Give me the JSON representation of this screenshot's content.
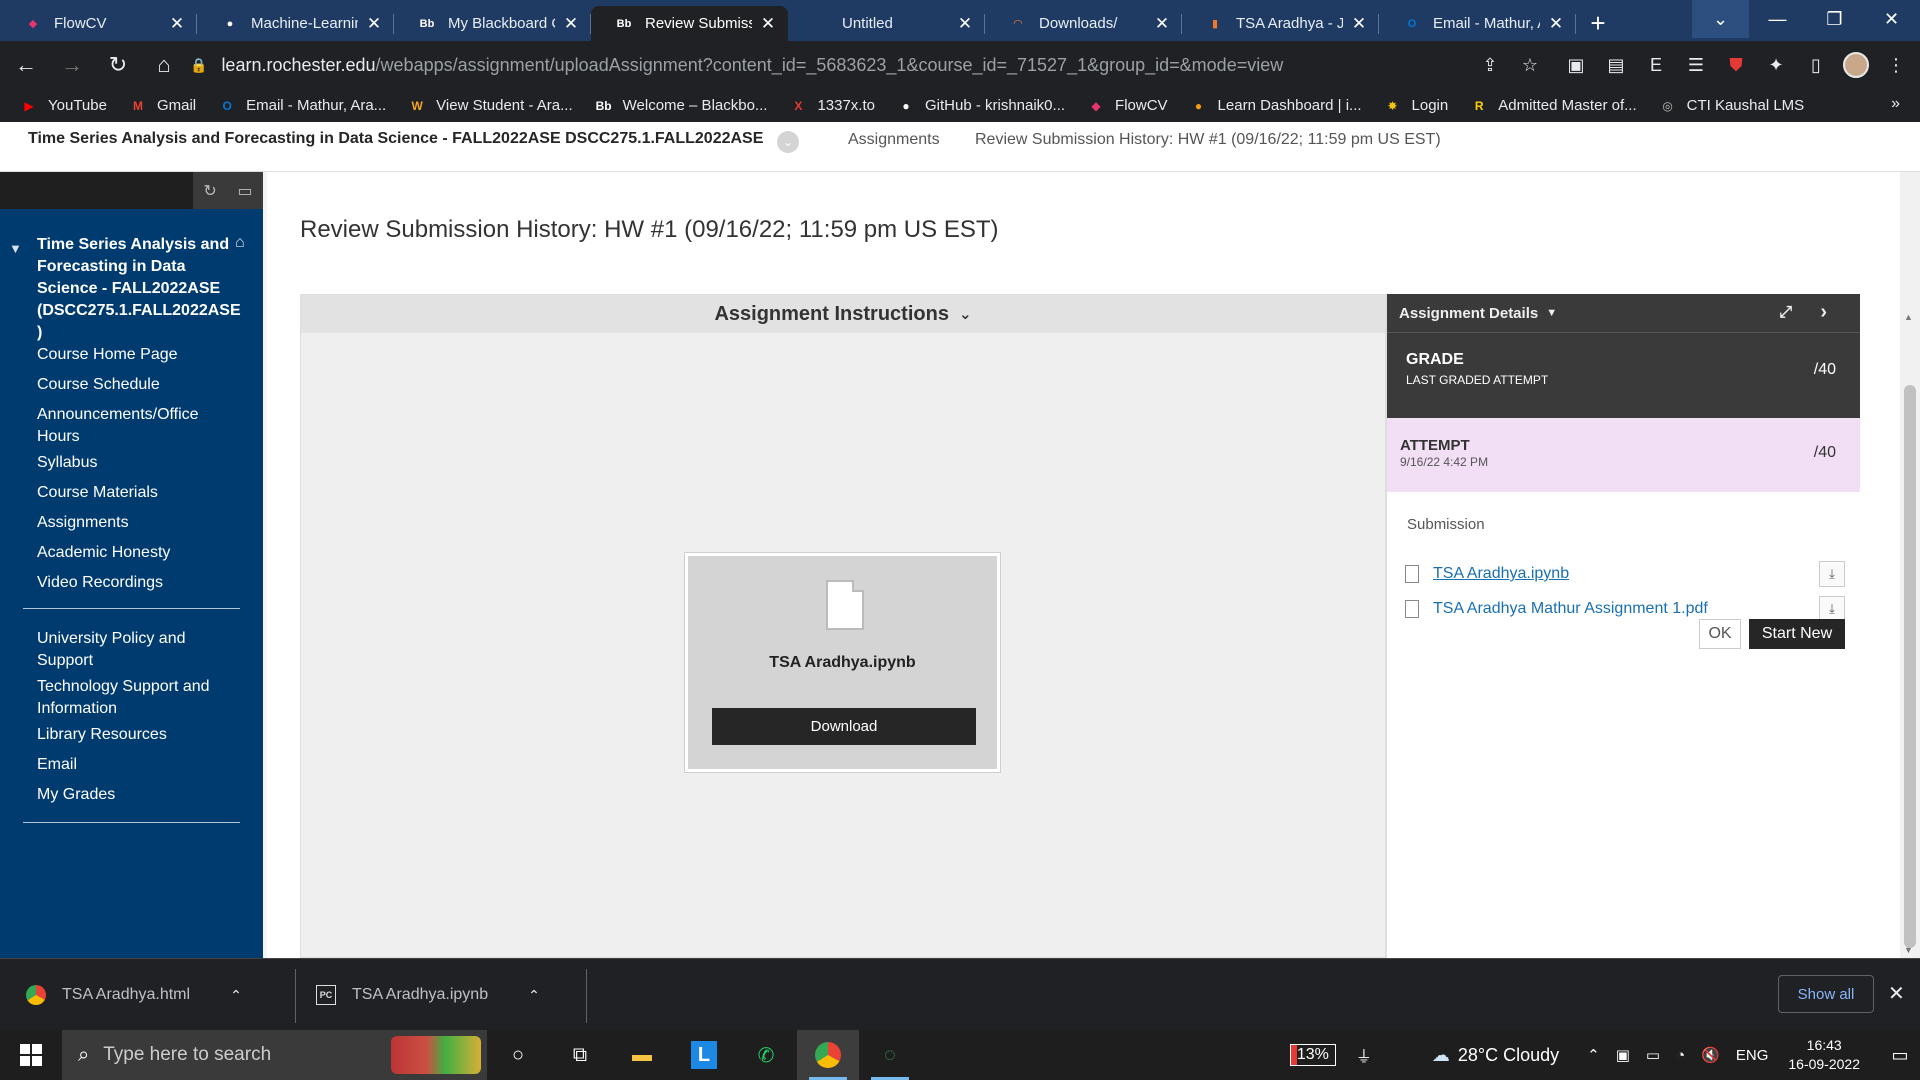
{
  "browser": {
    "tabs": [
      {
        "title": "FlowCV",
        "icon": "flowcv-icon",
        "color": "#e8336d",
        "glyph": "◆"
      },
      {
        "title": "Machine-Learning",
        "icon": "github-icon",
        "color": "#ffffff",
        "glyph": "●"
      },
      {
        "title": "My Blackboard C",
        "icon": "blackboard-icon",
        "color": "#ffffff",
        "glyph": "Bb"
      },
      {
        "title": "Review Submissio",
        "icon": "blackboard-icon",
        "color": "#ffffff",
        "glyph": "Bb",
        "active": true
      },
      {
        "title": "Untitled",
        "icon": "blank-icon",
        "color": "#ffffff",
        "glyph": ""
      },
      {
        "title": "Downloads/",
        "icon": "jupyter-icon",
        "color": "#f37726",
        "glyph": "◠"
      },
      {
        "title": "TSA Aradhya - Ju",
        "icon": "jupyter-notebook-icon",
        "color": "#f37726",
        "glyph": "▮"
      },
      {
        "title": "Email - Mathur, A",
        "icon": "outlook-icon",
        "color": "#0078d4",
        "glyph": "O"
      }
    ],
    "new_tab": "+",
    "address": {
      "domain": "learn.rochester.edu",
      "path": "/webapps/assignment/uploadAssignment?content_id=_5683623_1&course_id=_71527_1&group_id=&mode=view"
    },
    "bookmarks": [
      {
        "label": "YouTube",
        "icon": "youtube-icon",
        "color": "#ff0000",
        "glyph": "▶"
      },
      {
        "label": "Gmail",
        "icon": "gmail-icon",
        "color": "#ea4335",
        "glyph": "M"
      },
      {
        "label": "Email - Mathur, Ara...",
        "icon": "outlook-icon",
        "color": "#0078d4",
        "glyph": "O"
      },
      {
        "label": "View Student - Ara...",
        "icon": "workday-icon",
        "color": "#f5a623",
        "glyph": "W"
      },
      {
        "label": "Welcome – Blackbo...",
        "icon": "blackboard-icon",
        "color": "#ffffff",
        "glyph": "Bb"
      },
      {
        "label": "1337x.to",
        "icon": "x-icon",
        "color": "#e53935",
        "glyph": "X"
      },
      {
        "label": "GitHub - krishnaik0...",
        "icon": "github-icon",
        "color": "#ffffff",
        "glyph": "●"
      },
      {
        "label": "FlowCV",
        "icon": "flowcv-icon",
        "color": "#e8336d",
        "glyph": "◆"
      },
      {
        "label": "Learn Dashboard | i...",
        "icon": "learn-icon",
        "color": "#f39c12",
        "glyph": "●"
      },
      {
        "label": "Login",
        "icon": "login-icon",
        "color": "#f1c40f",
        "glyph": "✸"
      },
      {
        "label": "Admitted Master of...",
        "icon": "rochester-icon",
        "color": "#ffd100",
        "glyph": "R"
      },
      {
        "label": "CTI Kaushal LMS",
        "icon": "globe-icon",
        "color": "#bbbbbb",
        "glyph": "◎"
      }
    ],
    "bookmarks_more": "»"
  },
  "page": {
    "breadcrumb": {
      "course": "Time Series Analysis and Forecasting in Data Science - FALL2022ASE DSCC275.1.FALL2022ASE",
      "section": "Assignments",
      "current": "Review Submission History: HW #1 (09/16/22; 11:59 pm US EST)"
    },
    "title": "Review Submission History: HW #1 (09/16/22; 11:59 pm US EST)",
    "sidebar": {
      "course_title": "Time Series Analysis and Forecasting in Data Science - FALL2022ASE (DSCC275.1.FALL2022ASE )",
      "items": [
        "Course Home Page",
        "Course Schedule",
        "Announcements/Office Hours",
        "Syllabus",
        "Course Materials",
        "Assignments",
        "Academic Honesty",
        "Video Recordings"
      ],
      "items2": [
        "University Policy and Support",
        "Technology Support and Information",
        "Library Resources",
        "Email",
        "My Grades"
      ]
    },
    "instructions": {
      "header": "Assignment Instructions",
      "file_name": "TSA Aradhya.ipynb",
      "download_label": "Download"
    },
    "details": {
      "header": "Assignment Details",
      "grade_label": "GRADE",
      "grade_sub": "LAST GRADED ATTEMPT",
      "grade_value": "/40",
      "attempt_label": "ATTEMPT",
      "attempt_date": "9/16/22 4:42 PM",
      "attempt_value": "/40",
      "submission_label": "Submission",
      "files": [
        "TSA Aradhya.ipynb",
        "TSA Aradhya Mathur Assignment 1.pdf"
      ],
      "ok_label": "OK",
      "start_new_label": "Start New"
    }
  },
  "downloads": {
    "items": [
      {
        "name": "TSA Aradhya.html",
        "icon": "chrome-icon"
      },
      {
        "name": "TSA Aradhya.ipynb",
        "icon": "pycharm-icon"
      }
    ],
    "show_all": "Show all"
  },
  "taskbar": {
    "search_placeholder": "Type here to search",
    "battery": "13%",
    "weather": "28°C  Cloudy",
    "language": "ENG",
    "time": "16:43",
    "date": "16-09-2022"
  }
}
